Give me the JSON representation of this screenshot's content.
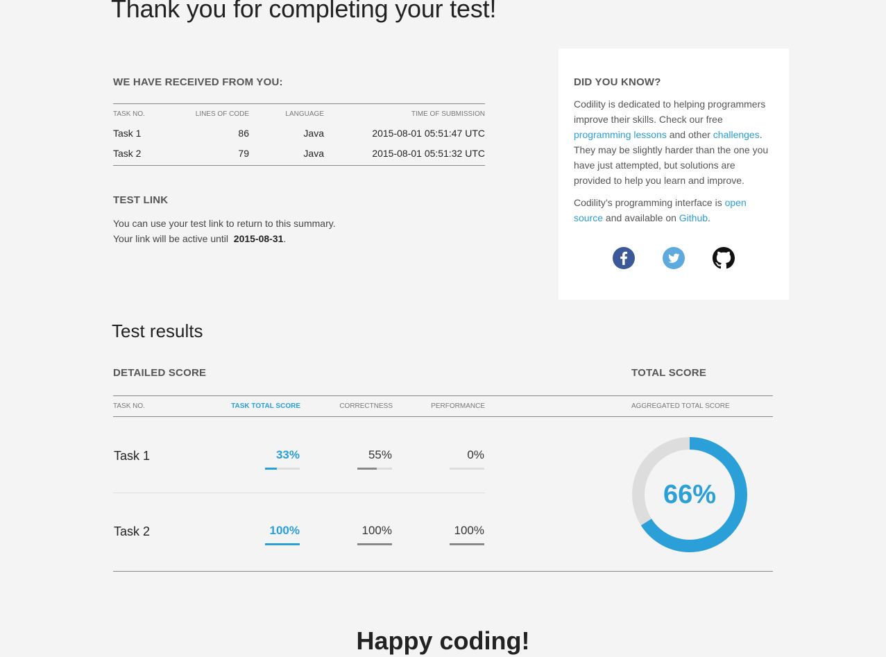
{
  "page": {
    "title": "Thank you for completing your test!",
    "footer": "Happy coding!"
  },
  "received": {
    "heading": "WE HAVE RECEIVED FROM YOU:",
    "columns": [
      "TASK NO.",
      "LINES OF CODE",
      "LANGUAGE",
      "TIME OF SUBMISSION"
    ],
    "rows": [
      {
        "task": "Task 1",
        "lines": "86",
        "language": "Java",
        "time": "2015-08-01 05:51:47 UTC"
      },
      {
        "task": "Task 2",
        "lines": "79",
        "language": "Java",
        "time": "2015-08-01 05:51:32 UTC"
      }
    ]
  },
  "test_link": {
    "heading": "TEST LINK",
    "line1": "You can use your test link to return to this summary.",
    "line2_prefix": "Your link will be active until",
    "active_until": "2015-08-31",
    "line2_suffix": "."
  },
  "did_you_know": {
    "heading": "DID YOU KNOW?",
    "p1_a": "Codility is dedicated to helping programmers improve their skills. Check our free ",
    "link_lessons": "programming lessons",
    "p1_b": " and other ",
    "link_challenges": "challenges",
    "p1_c": ". They may be slightly harder than the one you have just attempted, but solutions are provided to help you learn and improve.",
    "p2_a": "Codility’s programming interface is ",
    "link_open_source": "open source",
    "p2_b": " and available on ",
    "link_github": "Github",
    "p2_c": ".",
    "social": [
      {
        "name": "facebook-icon",
        "color": "#3b5998"
      },
      {
        "name": "twitter-icon",
        "color": "#5ea9dd"
      },
      {
        "name": "github-icon",
        "color": "#111111"
      }
    ]
  },
  "results": {
    "title": "Test results",
    "detailed_heading": "DETAILED SCORE",
    "total_heading": "TOTAL SCORE",
    "columns": {
      "task": "TASK NO.",
      "task_total": "TASK TOTAL SCORE",
      "correctness": "CORRECTNESS",
      "performance": "PERFORMANCE",
      "aggregated": "AGGREGATED TOTAL SCORE"
    },
    "tasks": [
      {
        "task": "Task 1",
        "total": "33%",
        "total_value": 33,
        "correctness": "55%",
        "correctness_value": 55,
        "performance": "0%",
        "performance_value": 0
      },
      {
        "task": "Task 2",
        "total": "100%",
        "total_value": 100,
        "correctness": "100%",
        "correctness_value": 100,
        "performance": "100%",
        "performance_value": 100
      }
    ],
    "aggregated_label": "66%",
    "aggregated_value": 66,
    "accent_color": "#2a9fd8",
    "track_color": "#dddddd"
  }
}
